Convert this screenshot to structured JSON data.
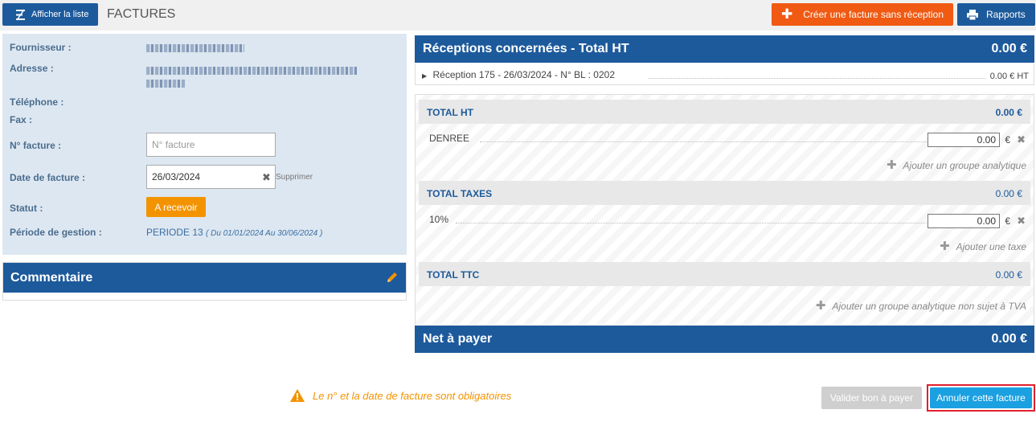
{
  "header": {
    "list_button": "Afficher la liste",
    "title": "FACTURES",
    "create_button": "Créer une facture sans réception",
    "reports_button": "Rapports"
  },
  "supplier": {
    "supplier_label": "Fournisseur :",
    "address_label": "Adresse :",
    "phone_label": "Téléphone :",
    "fax_label": "Fax :",
    "invoice_no_label": "N° facture :",
    "invoice_no_value": "",
    "invoice_no_placeholder": "N° facture",
    "invoice_date_label": "Date de facture :",
    "invoice_date_value": "26/03/2024",
    "delete_label": "Supprimer",
    "status_label": "Statut :",
    "status_value": "A recevoir",
    "period_label": "Période de gestion :",
    "period_value": "PERIODE 13",
    "period_range": "( Du 01/01/2024 Au 30/06/2024 )"
  },
  "comment": {
    "title": "Commentaire"
  },
  "receptions": {
    "title": "Réceptions concernées - Total HT",
    "total": "0.00 €",
    "items": [
      {
        "label": "Réception 175  -  26/03/2024  -  N° BL : 0202",
        "amount": "0.00 € HT"
      }
    ]
  },
  "totals": {
    "ht_label": "TOTAL HT",
    "ht_value": "0.00 €",
    "ht_lines": [
      {
        "label": "DENREE",
        "value": "0.00",
        "currency": "€"
      }
    ],
    "add_analytic_group": "Ajouter un groupe analytique",
    "taxes_label": "TOTAL TAXES",
    "taxes_value": "0.00 €",
    "tax_lines": [
      {
        "label": "10%",
        "value": "0.00",
        "currency": "€"
      }
    ],
    "add_tax": "Ajouter une taxe",
    "ttc_label": "TOTAL TTC",
    "ttc_value": "0.00 €",
    "add_analytic_group_no_vat": "Ajouter un groupe analytique non sujet à TVA"
  },
  "net_pay": {
    "label": "Net à payer",
    "value": "0.00 €"
  },
  "footer": {
    "warning": "Le n° et la date de facture sont obligatoires",
    "validate_button": "Valider bon à payer",
    "cancel_button": "Annuler cette facture"
  },
  "colors": {
    "primary_blue": "#1d5a9c",
    "orange": "#f05a13",
    "status_orange": "#f39300",
    "cancel_blue": "#1ba0e1",
    "highlight_red": "#e0202e"
  }
}
